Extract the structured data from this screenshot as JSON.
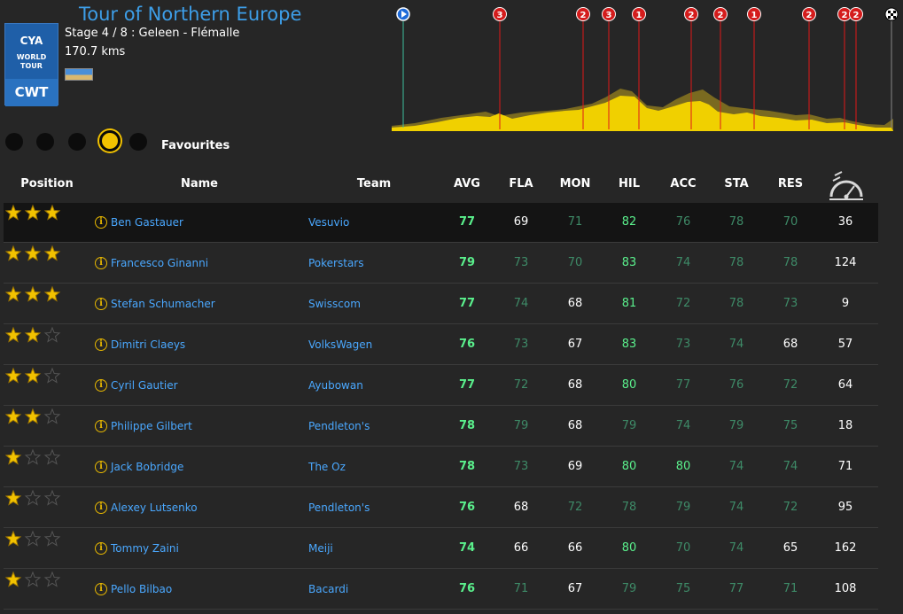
{
  "race": {
    "title": "Tour of Northern Europe",
    "stage": "Stage 4 / 8 : Geleen - Flémalle",
    "distance": "170.7 kms",
    "logo": {
      "line1": "CYA",
      "line2a": "WORLD",
      "line2b": "TOUR",
      "line3": "CWT"
    }
  },
  "profile": {
    "markers": [
      "3",
      "2",
      "3",
      "1",
      "2",
      "2",
      "1",
      "2",
      "2",
      "2"
    ]
  },
  "favourites": {
    "label": "Favourites",
    "dots": 5,
    "active_index": 3
  },
  "columns": {
    "position": "Position",
    "name": "Name",
    "team": "Team",
    "avg": "AVG",
    "fla": "FLA",
    "mon": "MON",
    "hil": "HIL",
    "acc": "ACC",
    "sta": "STA",
    "res": "RES"
  },
  "colors": {
    "bright_green": "#5af08c",
    "muted_green": "#3e8a67",
    "white": "#ffffff",
    "link_blue": "#4aa8ff",
    "star_gold": "#f2c200"
  },
  "riders": [
    {
      "stars": 3,
      "name": "Ben Gastauer",
      "team": "Vesuvio",
      "avg": "77",
      "fla": "69",
      "mon": "71",
      "hil": "82",
      "acc": "76",
      "sta": "78",
      "res": "70",
      "last": "36",
      "tones": {
        "fla": "w",
        "mon": "m",
        "hil": "b",
        "acc": "m",
        "sta": "m",
        "res": "m"
      }
    },
    {
      "stars": 3,
      "name": "Francesco Ginanni",
      "team": "Pokerstars",
      "avg": "79",
      "fla": "73",
      "mon": "70",
      "hil": "83",
      "acc": "74",
      "sta": "78",
      "res": "78",
      "last": "124",
      "tones": {
        "fla": "m",
        "mon": "m",
        "hil": "b",
        "acc": "m",
        "sta": "m",
        "res": "m"
      }
    },
    {
      "stars": 3,
      "name": "Stefan Schumacher",
      "team": "Swisscom",
      "avg": "77",
      "fla": "74",
      "mon": "68",
      "hil": "81",
      "acc": "72",
      "sta": "78",
      "res": "73",
      "last": "9",
      "tones": {
        "fla": "m",
        "mon": "w",
        "hil": "b",
        "acc": "m",
        "sta": "m",
        "res": "m"
      }
    },
    {
      "stars": 2,
      "name": "Dimitri Claeys",
      "team": "VolksWagen",
      "avg": "76",
      "fla": "73",
      "mon": "67",
      "hil": "83",
      "acc": "73",
      "sta": "74",
      "res": "68",
      "last": "57",
      "tones": {
        "fla": "m",
        "mon": "w",
        "hil": "b",
        "acc": "m",
        "sta": "m",
        "res": "w"
      }
    },
    {
      "stars": 2,
      "name": "Cyril Gautier",
      "team": "Ayubowan",
      "avg": "77",
      "fla": "72",
      "mon": "68",
      "hil": "80",
      "acc": "77",
      "sta": "76",
      "res": "72",
      "last": "64",
      "tones": {
        "fla": "m",
        "mon": "w",
        "hil": "b",
        "acc": "m",
        "sta": "m",
        "res": "m"
      }
    },
    {
      "stars": 2,
      "name": "Philippe Gilbert",
      "team": "Pendleton's",
      "avg": "78",
      "fla": "79",
      "mon": "68",
      "hil": "79",
      "acc": "74",
      "sta": "79",
      "res": "75",
      "last": "18",
      "tones": {
        "fla": "m",
        "mon": "w",
        "hil": "m",
        "acc": "m",
        "sta": "m",
        "res": "m"
      }
    },
    {
      "stars": 1,
      "name": "Jack Bobridge",
      "team": "The Oz",
      "avg": "78",
      "fla": "73",
      "mon": "69",
      "hil": "80",
      "acc": "80",
      "sta": "74",
      "res": "74",
      "last": "71",
      "tones": {
        "fla": "m",
        "mon": "w",
        "hil": "b",
        "acc": "b",
        "sta": "m",
        "res": "m"
      }
    },
    {
      "stars": 1,
      "name": "Alexey Lutsenko",
      "team": "Pendleton's",
      "avg": "76",
      "fla": "68",
      "mon": "72",
      "hil": "78",
      "acc": "79",
      "sta": "74",
      "res": "72",
      "last": "95",
      "tones": {
        "fla": "w",
        "mon": "m",
        "hil": "m",
        "acc": "m",
        "sta": "m",
        "res": "m"
      }
    },
    {
      "stars": 1,
      "name": "Tommy Zaini",
      "team": "Meiji",
      "avg": "74",
      "fla": "66",
      "mon": "66",
      "hil": "80",
      "acc": "70",
      "sta": "74",
      "res": "65",
      "last": "162",
      "tones": {
        "fla": "w",
        "mon": "w",
        "hil": "b",
        "acc": "m",
        "sta": "m",
        "res": "w"
      }
    },
    {
      "stars": 1,
      "name": "Pello Bilbao",
      "team": "Bacardi",
      "avg": "76",
      "fla": "71",
      "mon": "67",
      "hil": "79",
      "acc": "75",
      "sta": "77",
      "res": "71",
      "last": "108",
      "tones": {
        "fla": "m",
        "mon": "w",
        "hil": "m",
        "acc": "m",
        "sta": "m",
        "res": "m"
      }
    }
  ]
}
